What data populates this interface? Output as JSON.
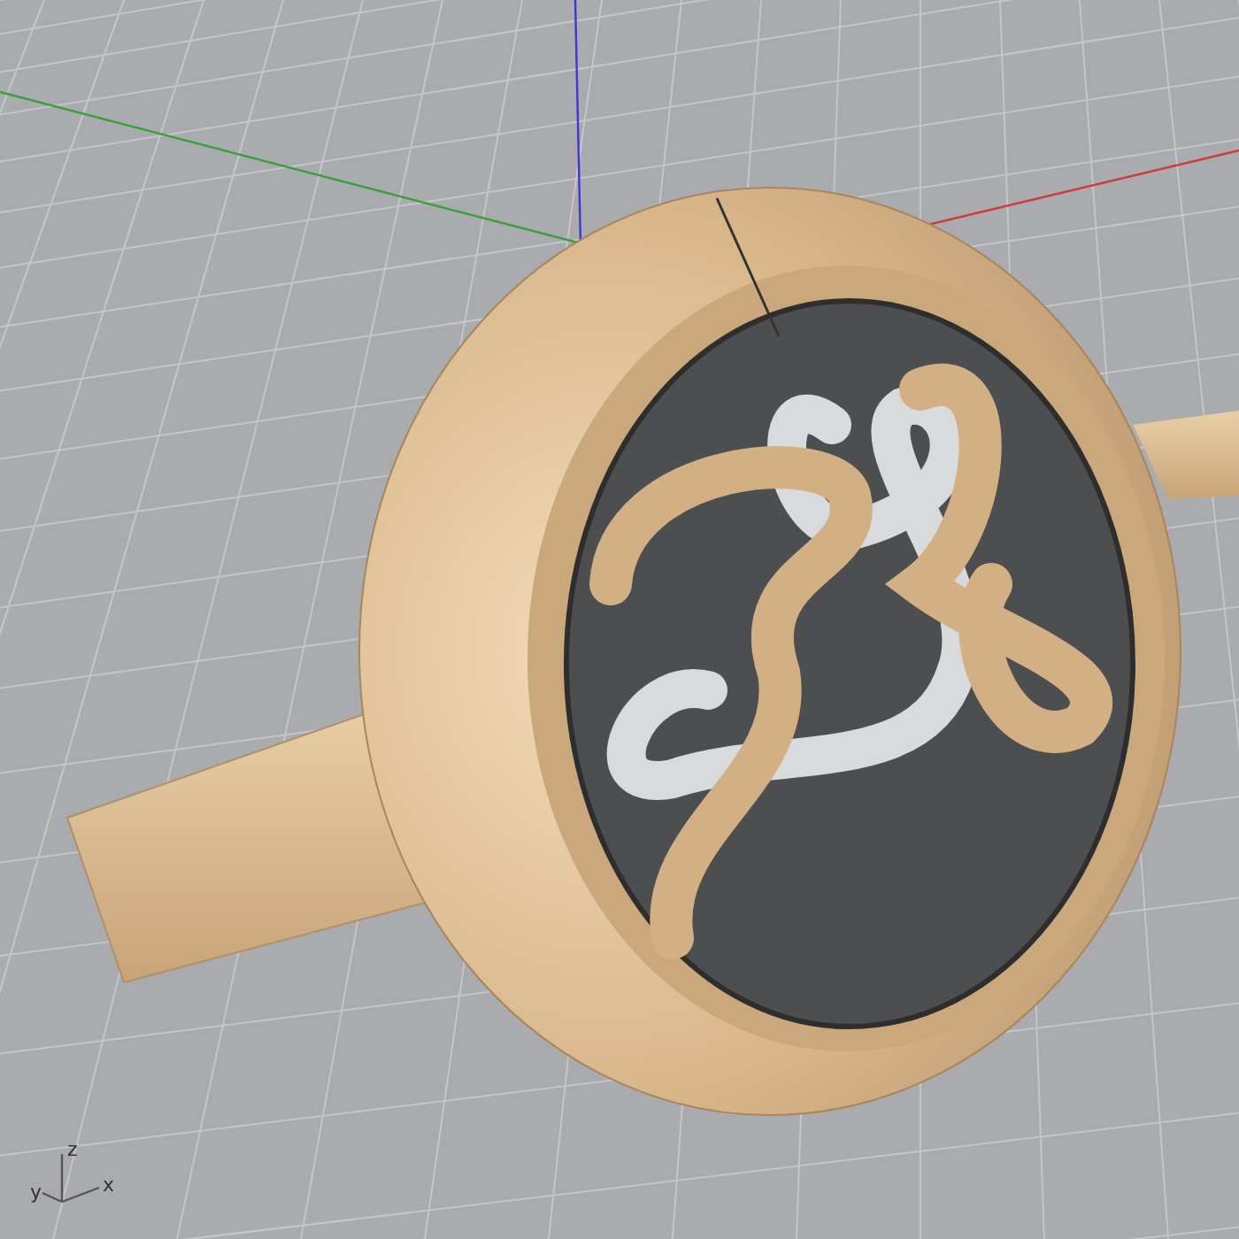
{
  "viewport": {
    "axis_labels": [
      "z",
      "y",
      "x"
    ]
  }
}
